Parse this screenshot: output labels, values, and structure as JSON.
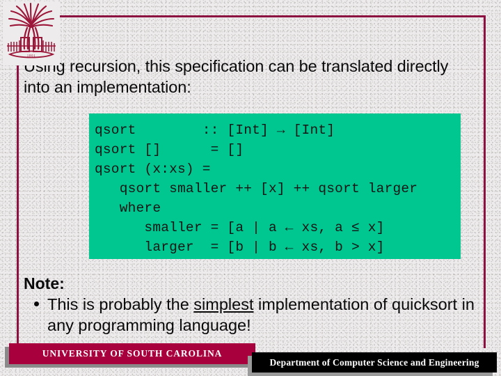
{
  "slide": {
    "headline": "Using recursion, this specification can be translated directly into an implementation:",
    "code": "qsort        :: [Int] → [Int]\nqsort []      = []\nqsort (x:xs) =\n   qsort smaller ++ [x] ++ qsort larger\n   where\n      smaller = [a | a ← xs, a ≤ x]\n      larger  = [b | b ← xs, b > x]",
    "note_title": "Note:",
    "note_items": [
      {
        "before": "This is probably the ",
        "emphasis": "simplest",
        "after": " implementation of quicksort in any programming language!"
      }
    ],
    "footer_left": "UNIVERSITY OF SOUTH CAROLINA",
    "footer_right": "Department of Computer Science and Engineering",
    "logo_alt": "usc-palmetto-seal"
  },
  "colors": {
    "frame": "#8c1040",
    "code_background": "#00c68f",
    "footer_left_background": "#a8003c",
    "footer_right_background": "#000000",
    "slide_background": "#edebeb"
  }
}
